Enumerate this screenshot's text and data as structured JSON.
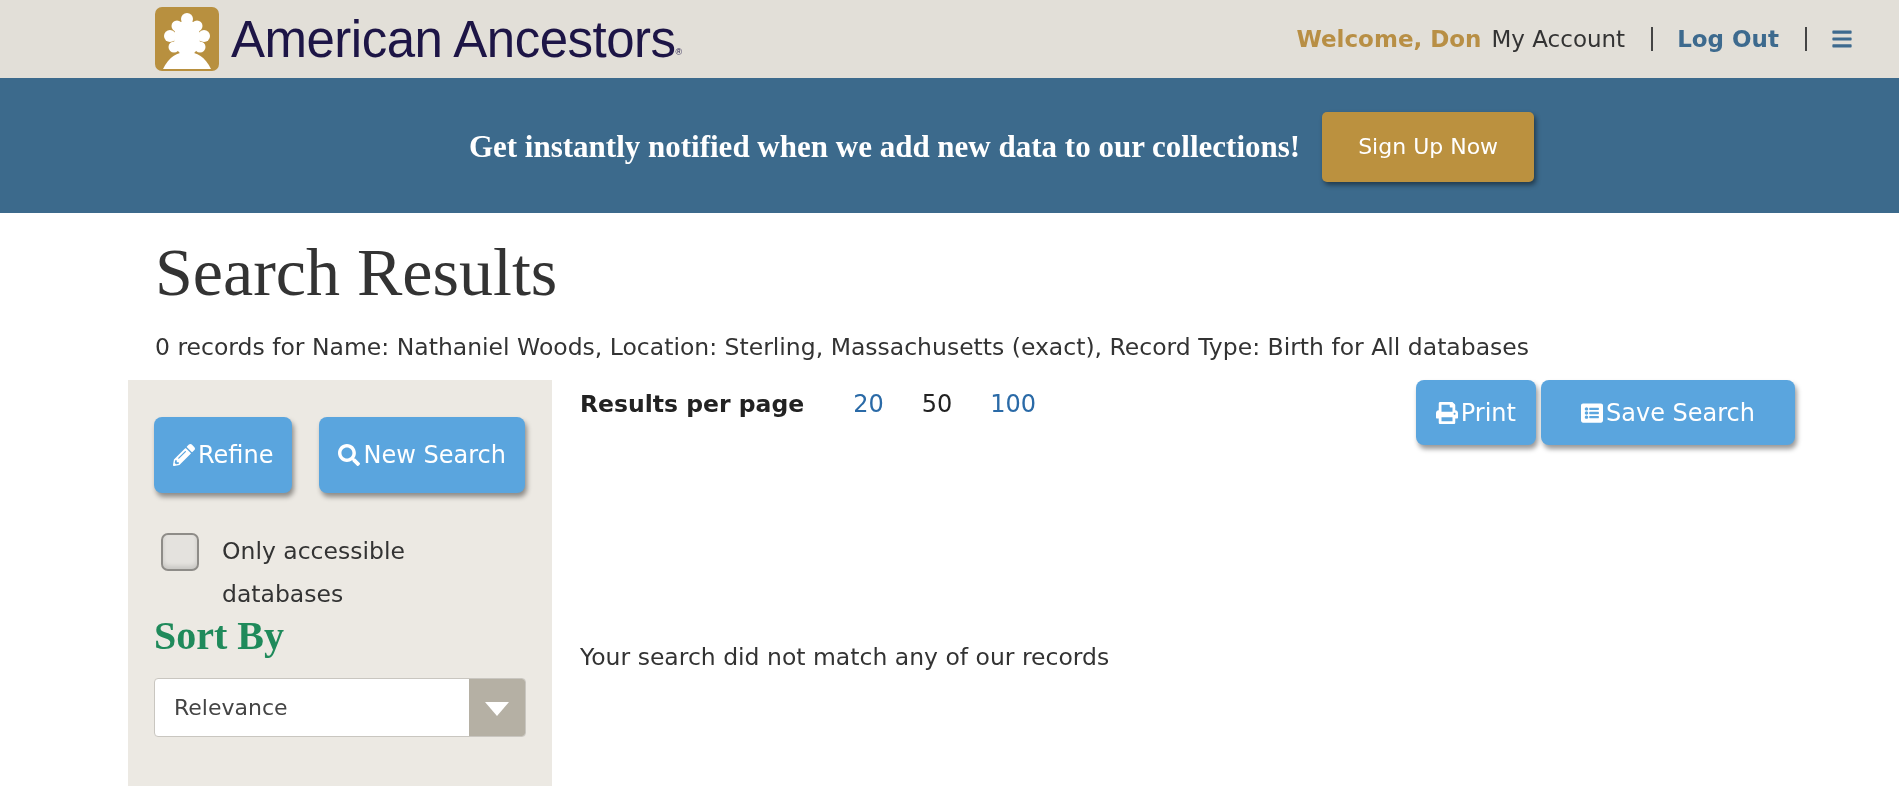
{
  "header": {
    "logo": {
      "name": "American Ancestors",
      "mark": "®"
    },
    "greeting": "Welcome, Don",
    "links": [
      {
        "label": "My Account",
        "kind": "plain"
      },
      {
        "label": "Log Out",
        "kind": "accent"
      }
    ]
  },
  "banner": {
    "message": "Get instantly notified when we add new data to our collections!",
    "button": "Sign Up Now"
  },
  "page": {
    "title": "Search Results",
    "summary": "0 records for Name: Nathaniel Woods, Location: Sterling, Massachusetts (exact), Record Type: Birth for All databases"
  },
  "sidebar": {
    "buttons": [
      {
        "label": "Refine",
        "kind": "refine"
      },
      {
        "label": "New Search",
        "kind": "search"
      }
    ],
    "filter": {
      "label": "Only accessible databases",
      "checked": false
    },
    "sort": {
      "heading": "Sort By",
      "value": "Relevance"
    }
  },
  "results": {
    "per_page": {
      "label": "Results per page",
      "options": [
        {
          "label": "20",
          "selected": false
        },
        {
          "label": "50",
          "selected": true
        },
        {
          "label": "100",
          "selected": false
        }
      ]
    },
    "actions": [
      {
        "label": "Print",
        "kind": "print"
      },
      {
        "label": "Save Search",
        "kind": "save"
      }
    ],
    "message": "Your search did not match any of our records"
  }
}
